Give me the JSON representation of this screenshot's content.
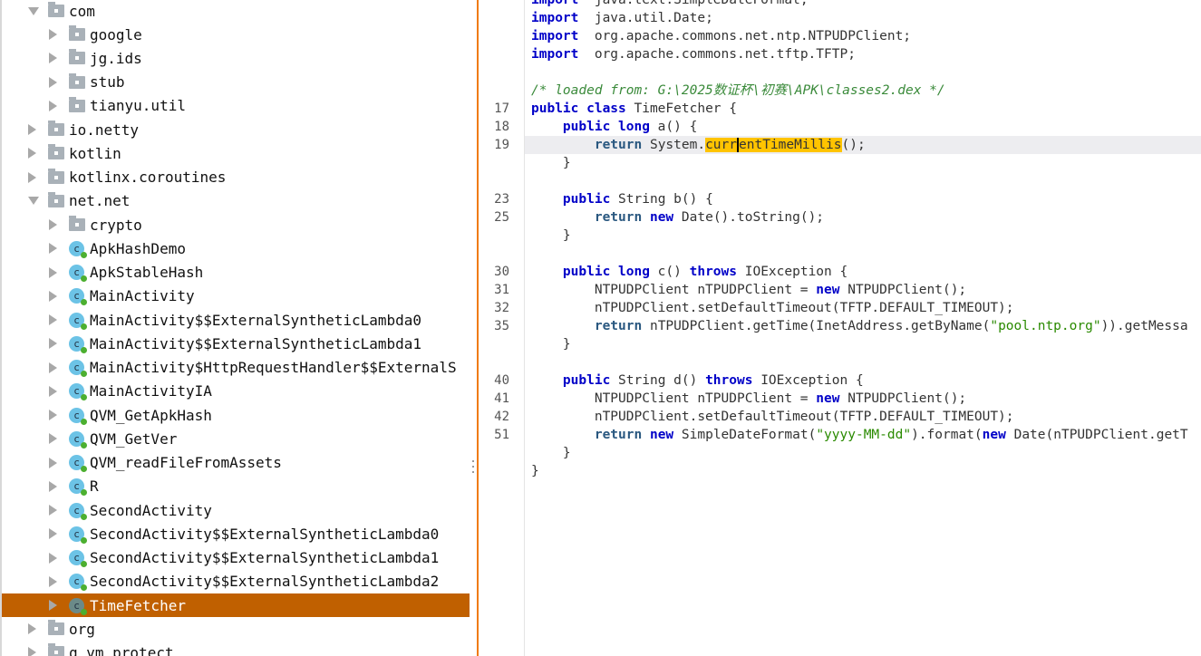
{
  "tree": [
    {
      "label": "com",
      "kind": "folder",
      "depth": 0,
      "open": true
    },
    {
      "label": "google",
      "kind": "folder",
      "depth": 1
    },
    {
      "label": "jg.ids",
      "kind": "folder",
      "depth": 1
    },
    {
      "label": "stub",
      "kind": "folder",
      "depth": 1
    },
    {
      "label": "tianyu.util",
      "kind": "folder",
      "depth": 1
    },
    {
      "label": "io.netty",
      "kind": "folder",
      "depth": 0
    },
    {
      "label": "kotlin",
      "kind": "folder",
      "depth": 0
    },
    {
      "label": "kotlinx.coroutines",
      "kind": "folder",
      "depth": 0
    },
    {
      "label": "net.net",
      "kind": "folder",
      "depth": 0,
      "open": true
    },
    {
      "label": "crypto",
      "kind": "folder",
      "depth": 1
    },
    {
      "label": "ApkHashDemo",
      "kind": "class",
      "depth": 1
    },
    {
      "label": "ApkStableHash",
      "kind": "class",
      "depth": 1
    },
    {
      "label": "MainActivity",
      "kind": "class",
      "depth": 1
    },
    {
      "label": "MainActivity$$ExternalSyntheticLambda0",
      "kind": "class",
      "depth": 1
    },
    {
      "label": "MainActivity$$ExternalSyntheticLambda1",
      "kind": "class",
      "depth": 1
    },
    {
      "label": "MainActivity$HttpRequestHandler$$ExternalS",
      "kind": "class",
      "depth": 1
    },
    {
      "label": "MainActivityIA",
      "kind": "class",
      "depth": 1
    },
    {
      "label": "QVM_GetApkHash",
      "kind": "class",
      "depth": 1
    },
    {
      "label": "QVM_GetVer",
      "kind": "class",
      "depth": 1
    },
    {
      "label": "QVM_readFileFromAssets",
      "kind": "class",
      "depth": 1
    },
    {
      "label": "R",
      "kind": "class",
      "depth": 1
    },
    {
      "label": "SecondActivity",
      "kind": "class",
      "depth": 1
    },
    {
      "label": "SecondActivity$$ExternalSyntheticLambda0",
      "kind": "class",
      "depth": 1
    },
    {
      "label": "SecondActivity$$ExternalSyntheticLambda1",
      "kind": "class",
      "depth": 1
    },
    {
      "label": "SecondActivity$$ExternalSyntheticLambda2",
      "kind": "class",
      "depth": 1
    },
    {
      "label": "TimeFetcher",
      "kind": "class",
      "depth": 1,
      "selected": true
    },
    {
      "label": "org",
      "kind": "folder",
      "depth": 0
    },
    {
      "label": "q_vm_protect",
      "kind": "folder",
      "depth": 0
    }
  ],
  "code": [
    {
      "n": "",
      "t": [
        [
          "kw",
          "import"
        ],
        [
          "",
          "  java.text.SimpleDateFormat;"
        ]
      ]
    },
    {
      "n": "",
      "t": [
        [
          "kw",
          "import"
        ],
        [
          "",
          "  java.util.Date;"
        ]
      ]
    },
    {
      "n": "",
      "t": [
        [
          "kw",
          "import"
        ],
        [
          "",
          "  org.apache.commons.net.ntp.NTPUDPClient;"
        ]
      ]
    },
    {
      "n": "",
      "t": [
        [
          "kw",
          "import"
        ],
        [
          "",
          "  org.apache.commons.net.tftp.TFTP;"
        ]
      ]
    },
    {
      "n": "",
      "t": []
    },
    {
      "n": "",
      "t": [
        [
          "cmt",
          "/* loaded from: G:\\2025数证杯\\初赛\\APK\\classes2.dex */"
        ]
      ]
    },
    {
      "n": "17",
      "t": [
        [
          "kw",
          "public class"
        ],
        [
          "",
          " TimeFetcher {"
        ]
      ]
    },
    {
      "n": "18",
      "t": [
        [
          "",
          "    "
        ],
        [
          "kw",
          "public long"
        ],
        [
          "",
          " a() {"
        ]
      ]
    },
    {
      "n": "19",
      "cur": true,
      "t": [
        [
          "",
          "        "
        ],
        [
          "ret",
          "return"
        ],
        [
          "",
          " System."
        ],
        [
          "hl",
          "curr"
        ],
        [
          "hl caret",
          "entTimeMillis"
        ],
        [
          "",
          "();"
        ]
      ]
    },
    {
      "n": "",
      "t": [
        [
          "",
          "    }"
        ]
      ]
    },
    {
      "n": "",
      "t": []
    },
    {
      "n": "23",
      "t": [
        [
          "",
          "    "
        ],
        [
          "kw",
          "public"
        ],
        [
          "",
          " String b() {"
        ]
      ]
    },
    {
      "n": "25",
      "t": [
        [
          "",
          "        "
        ],
        [
          "ret",
          "return"
        ],
        [
          "",
          " "
        ],
        [
          "kw",
          "new"
        ],
        [
          "",
          " Date().toString();"
        ]
      ]
    },
    {
      "n": "",
      "t": [
        [
          "",
          "    }"
        ]
      ]
    },
    {
      "n": "",
      "t": []
    },
    {
      "n": "30",
      "t": [
        [
          "",
          "    "
        ],
        [
          "kw",
          "public long"
        ],
        [
          "",
          " c() "
        ],
        [
          "kw",
          "throws"
        ],
        [
          "",
          " IOException {"
        ]
      ]
    },
    {
      "n": "31",
      "t": [
        [
          "",
          "        NTPUDPClient nTPUDPClient = "
        ],
        [
          "kw",
          "new"
        ],
        [
          "",
          " NTPUDPClient();"
        ]
      ]
    },
    {
      "n": "32",
      "t": [
        [
          "",
          "        nTPUDPClient.setDefaultTimeout(TFTP.DEFAULT_TIMEOUT);"
        ]
      ]
    },
    {
      "n": "35",
      "t": [
        [
          "",
          "        "
        ],
        [
          "ret",
          "return"
        ],
        [
          "",
          " nTPUDPClient.getTime(InetAddress.getByName("
        ],
        [
          "str",
          "\"pool.ntp.org\""
        ],
        [
          "",
          ")).getMessa"
        ]
      ]
    },
    {
      "n": "",
      "t": [
        [
          "",
          "    }"
        ]
      ]
    },
    {
      "n": "",
      "t": []
    },
    {
      "n": "40",
      "t": [
        [
          "",
          "    "
        ],
        [
          "kw",
          "public"
        ],
        [
          "",
          " String d() "
        ],
        [
          "kw",
          "throws"
        ],
        [
          "",
          " IOException {"
        ]
      ]
    },
    {
      "n": "41",
      "t": [
        [
          "",
          "        NTPUDPClient nTPUDPClient = "
        ],
        [
          "kw",
          "new"
        ],
        [
          "",
          " NTPUDPClient();"
        ]
      ]
    },
    {
      "n": "42",
      "t": [
        [
          "",
          "        nTPUDPClient.setDefaultTimeout(TFTP.DEFAULT_TIMEOUT);"
        ]
      ]
    },
    {
      "n": "51",
      "t": [
        [
          "",
          "        "
        ],
        [
          "ret",
          "return"
        ],
        [
          "",
          " "
        ],
        [
          "kw",
          "new"
        ],
        [
          "",
          " SimpleDateFormat("
        ],
        [
          "str",
          "\"yyyy-MM-dd\""
        ],
        [
          "",
          ").format("
        ],
        [
          "kw",
          "new"
        ],
        [
          "",
          " Date(nTPUDPClient.getT"
        ]
      ]
    },
    {
      "n": "",
      "t": [
        [
          "",
          "    }"
        ]
      ]
    },
    {
      "n": "",
      "t": [
        [
          "",
          "}"
        ]
      ]
    }
  ]
}
